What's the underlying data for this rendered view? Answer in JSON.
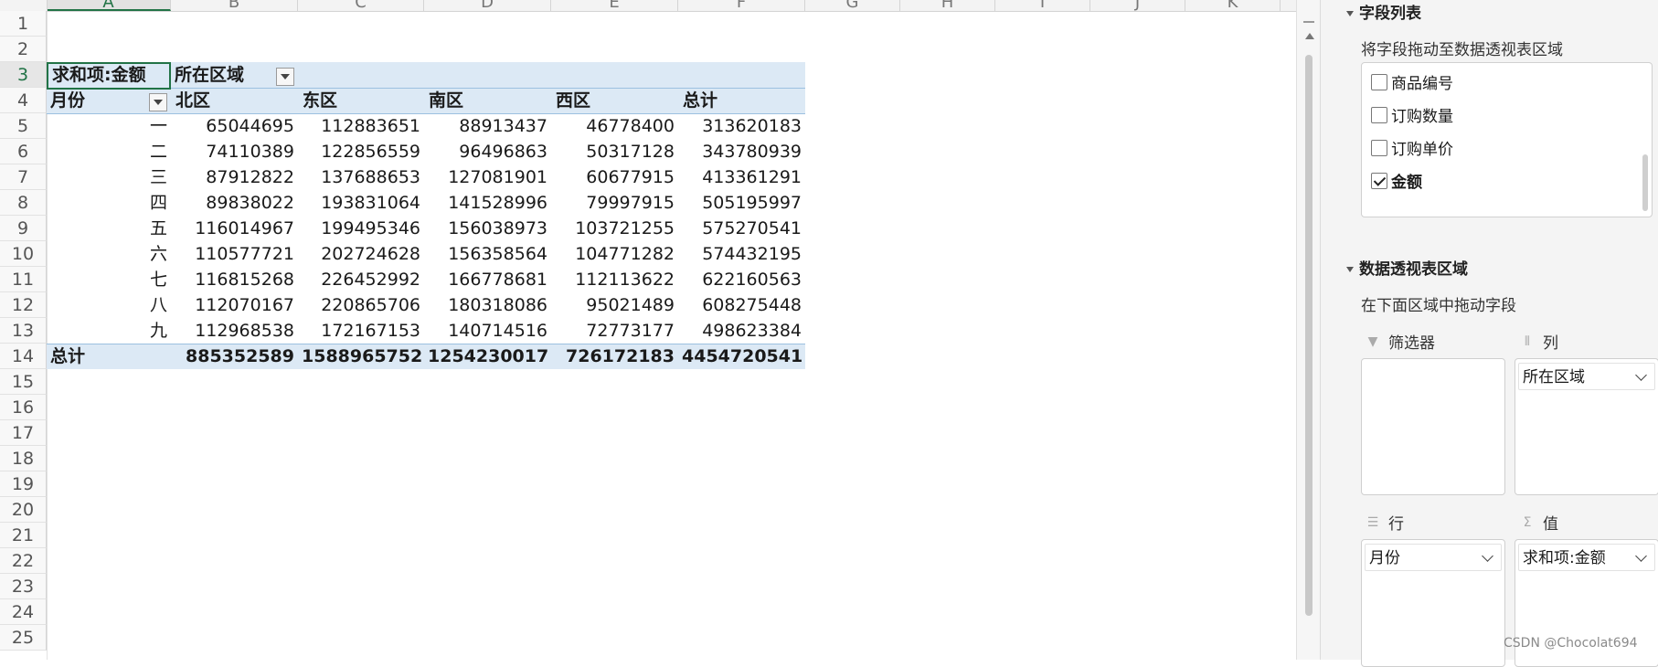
{
  "sheet": {
    "columns": [
      "A",
      "B",
      "C",
      "D",
      "E",
      "F",
      "G",
      "H",
      "I",
      "J",
      "K"
    ],
    "rows": [
      "1",
      "2",
      "3",
      "4",
      "5",
      "6",
      "7",
      "8",
      "9",
      "10",
      "11",
      "12",
      "13",
      "14",
      "15",
      "16",
      "17",
      "18",
      "19",
      "20",
      "21",
      "22",
      "23",
      "24",
      "25"
    ],
    "active_column": "A",
    "active_row": "3"
  },
  "pivot": {
    "value_caption": "求和项:金额",
    "column_field": "所在区域",
    "row_field": "月份",
    "col_headers": [
      "北区",
      "东区",
      "南区",
      "西区",
      "总计"
    ],
    "rows": [
      {
        "label": "一",
        "values": [
          "65044695",
          "112883651",
          "88913437",
          "46778400",
          "313620183"
        ]
      },
      {
        "label": "二",
        "values": [
          "74110389",
          "122856559",
          "96496863",
          "50317128",
          "343780939"
        ]
      },
      {
        "label": "三",
        "values": [
          "87912822",
          "137688653",
          "127081901",
          "60677915",
          "413361291"
        ]
      },
      {
        "label": "四",
        "values": [
          "89838022",
          "193831064",
          "141528996",
          "79997915",
          "505195997"
        ]
      },
      {
        "label": "五",
        "values": [
          "116014967",
          "199495346",
          "156038973",
          "103721255",
          "575270541"
        ]
      },
      {
        "label": "六",
        "values": [
          "110577721",
          "202724628",
          "156358564",
          "104771282",
          "574432195"
        ]
      },
      {
        "label": "七",
        "values": [
          "116815268",
          "226452992",
          "166778681",
          "112113622",
          "622160563"
        ]
      },
      {
        "label": "八",
        "values": [
          "112070167",
          "220865706",
          "180318086",
          "95021489",
          "608275448"
        ]
      },
      {
        "label": "九",
        "values": [
          "112968538",
          "172167153",
          "140714516",
          "72773177",
          "498623384"
        ]
      }
    ],
    "total_label": "总计",
    "total_values": [
      "885352589",
      "1588965752",
      "1254230017",
      "726172183",
      "4454720541"
    ]
  },
  "panel": {
    "field_list_title": "字段列表",
    "field_list_hint": "将字段拖动至数据透视表区域",
    "fields": [
      {
        "label": "商品编号",
        "checked": false
      },
      {
        "label": "订购数量",
        "checked": false
      },
      {
        "label": "订购单价",
        "checked": false
      },
      {
        "label": "金额",
        "checked": true
      }
    ],
    "areas_title": "数据透视表区域",
    "areas_hint": "在下面区域中拖动字段",
    "filter_label": "筛选器",
    "column_label": "列",
    "row_label": "行",
    "value_label": "值",
    "column_chip": "所在区域",
    "row_chip": "月份",
    "value_chip": "求和项:金额"
  },
  "watermark": "CSDN @Chocolat694"
}
